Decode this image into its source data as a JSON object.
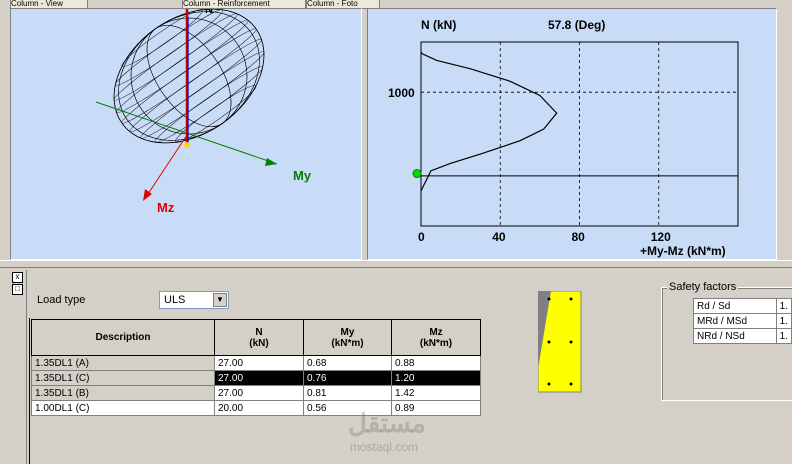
{
  "tabs": [
    "Column - View",
    "Column - Reinforcement",
    "Column - Foto"
  ],
  "view3d": {
    "axis_n": "N",
    "axis_my": "My",
    "axis_mz": "Mz",
    "colors": {
      "n": "#d00000",
      "my": "#008000",
      "mz": "#e00000",
      "mesh": "#000000"
    }
  },
  "chart": {
    "ylabel": "N (kN)",
    "angle_label": "57.8 (Deg)",
    "xlabel": "+My-Mz (kN*m)",
    "y_tick_labels": [
      "1000"
    ],
    "x_tick_labels": [
      "0",
      "40",
      "80",
      "120"
    ]
  },
  "chart_data": {
    "type": "line",
    "title": "57.8 (Deg)",
    "xlabel": "+My-Mz (kN*m)",
    "ylabel": "N (kN)",
    "xlim": [
      0,
      160
    ],
    "ylim": [
      -600,
      1600
    ],
    "grid": true,
    "x_ticks": [
      0,
      40,
      80,
      120
    ],
    "y_ticks": [
      1000
    ],
    "series": [
      {
        "x": [
          0,
          0.5,
          8,
          25,
          45,
          60,
          68.5,
          62,
          50,
          30,
          15,
          5,
          0
        ],
        "y": [
          1480,
          1460,
          1380,
          1280,
          1130,
          960,
          750,
          560,
          420,
          260,
          150,
          60,
          -180
        ]
      }
    ],
    "points": [
      {
        "x": 0,
        "y": 27
      }
    ]
  },
  "toolbar": {
    "pin_icon": "x",
    "restore_icon": "□"
  },
  "load_type": {
    "label": "Load type",
    "value": "ULS"
  },
  "table": {
    "headers": [
      {
        "line1": "Description",
        "line2": ""
      },
      {
        "line1": "N",
        "line2": "(kN)"
      },
      {
        "line1": "My",
        "line2": "(kN*m)"
      },
      {
        "line1": "Mz",
        "line2": "(kN*m)"
      }
    ],
    "rows": [
      {
        "desc": "1.35DL1 (A)",
        "n": "27.00",
        "my": "0.68",
        "mz": "0.88"
      },
      {
        "desc": "1.35DL1 (C)",
        "n": "27.00",
        "my": "0.76",
        "mz": "1.20"
      },
      {
        "desc": "1.35DL1 (B)",
        "n": "27.00",
        "my": "0.81",
        "mz": "1.42"
      },
      {
        "desc": "1.00DL1 (C)",
        "n": "20.00",
        "my": "0.56",
        "mz": "0.89"
      }
    ],
    "selected_index": 1
  },
  "safety": {
    "title": "Safety factors",
    "rows": [
      {
        "label": "Rd / Sd",
        "value": "1."
      },
      {
        "label": "MRd / MSd",
        "value": "1."
      },
      {
        "label": "NRd / NSd",
        "value": "1."
      }
    ]
  },
  "watermark": {
    "arabic": "مستقل",
    "latin": "mostaql.com"
  }
}
